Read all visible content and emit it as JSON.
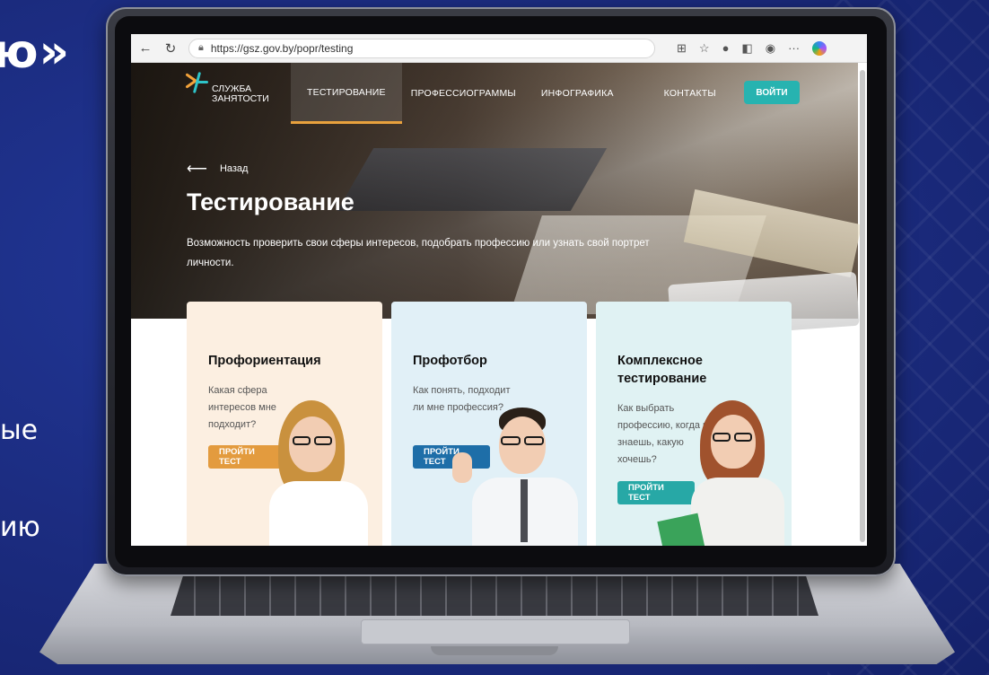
{
  "slide": {
    "title_fragment": "ю»",
    "text_fragment_1": "ые",
    "text_fragment_2": "ию"
  },
  "browser": {
    "url": "https://gsz.gov.by/popr/testing"
  },
  "site": {
    "logo_line1": "СЛУЖБА",
    "logo_line2": "ЗАНЯТОСТИ",
    "nav": [
      {
        "label": "ТЕСТИРОВАНИЕ"
      },
      {
        "label": "ПРОФЕССИОГРАММЫ"
      },
      {
        "label": "ИНФОГРАФИКА"
      },
      {
        "label": "КОНТАКТЫ"
      }
    ],
    "login_label": "ВОЙТИ",
    "back_label": "Назад",
    "hero_title": "Тестирование",
    "hero_subtitle": "Возможность проверить свои сферы интересов, подобрать профессию или узнать свой портрет личности."
  },
  "cards": [
    {
      "title": "Профориентация",
      "desc": "Какая сфера интересов мне подходит?",
      "button": "ПРОЙТИ ТЕСТ",
      "accent": "#e39b3e"
    },
    {
      "title": "Профотбор",
      "desc": "Как понять, подходит ли мне профессия?",
      "button": "ПРОЙТИ ТЕСТ",
      "accent": "#1e6ea8"
    },
    {
      "title": "Комплексное тестирование",
      "desc": "Как выбрать профессию, когда не знаешь, какую хочешь?",
      "button": "ПРОЙТИ ТЕСТ",
      "accent": "#27a8a6"
    }
  ],
  "colors": {
    "slide_bg": "#1d2f86",
    "login_button": "#27b3b0",
    "active_nav_underline": "#e8a13d"
  }
}
